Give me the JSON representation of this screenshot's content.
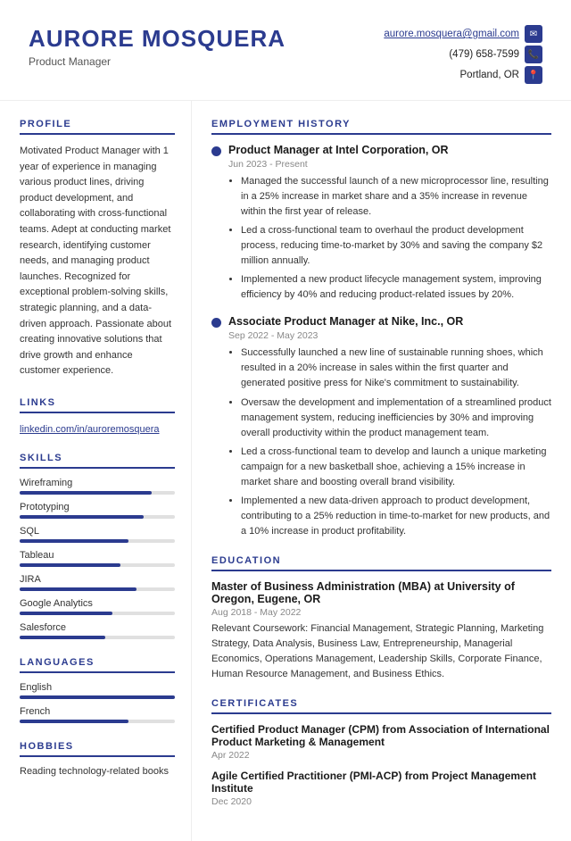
{
  "header": {
    "name": "AURORE MOSQUERA",
    "title": "Product Manager",
    "email": "aurore.mosquera@gmail.com",
    "phone": "(479) 658-7599",
    "location": "Portland, OR"
  },
  "profile": {
    "section_title": "PROFILE",
    "text": "Motivated Product Manager with 1 year of experience in managing various product lines, driving product development, and collaborating with cross-functional teams. Adept at conducting market research, identifying customer needs, and managing product launches. Recognized for exceptional problem-solving skills, strategic planning, and a data-driven approach. Passionate about creating innovative solutions that drive growth and enhance customer experience."
  },
  "links": {
    "section_title": "LINKS",
    "linkedin": "linkedin.com/in/auroremosquera"
  },
  "skills": {
    "section_title": "SKILLS",
    "items": [
      {
        "name": "Wireframing",
        "level": 85
      },
      {
        "name": "Prototyping",
        "level": 80
      },
      {
        "name": "SQL",
        "level": 70
      },
      {
        "name": "Tableau",
        "level": 65
      },
      {
        "name": "JIRA",
        "level": 75
      },
      {
        "name": "Google Analytics",
        "level": 60
      },
      {
        "name": "Salesforce",
        "level": 55
      }
    ]
  },
  "languages": {
    "section_title": "LANGUAGES",
    "items": [
      {
        "name": "English",
        "level": 100
      },
      {
        "name": "French",
        "level": 70
      }
    ]
  },
  "hobbies": {
    "section_title": "HOBBIES",
    "text": "Reading technology-related books"
  },
  "employment": {
    "section_title": "EMPLOYMENT HISTORY",
    "jobs": [
      {
        "title": "Product Manager at Intel Corporation, OR",
        "dates": "Jun 2023 - Present",
        "bullets": [
          "Managed the successful launch of a new microprocessor line, resulting in a 25% increase in market share and a 35% increase in revenue within the first year of release.",
          "Led a cross-functional team to overhaul the product development process, reducing time-to-market by 30% and saving the company $2 million annually.",
          "Implemented a new product lifecycle management system, improving efficiency by 40% and reducing product-related issues by 20%."
        ]
      },
      {
        "title": "Associate Product Manager at Nike, Inc., OR",
        "dates": "Sep 2022 - May 2023",
        "bullets": [
          "Successfully launched a new line of sustainable running shoes, which resulted in a 20% increase in sales within the first quarter and generated positive press for Nike's commitment to sustainability.",
          "Oversaw the development and implementation of a streamlined product management system, reducing inefficiencies by 30% and improving overall productivity within the product management team.",
          "Led a cross-functional team to develop and launch a unique marketing campaign for a new basketball shoe, achieving a 15% increase in market share and boosting overall brand visibility.",
          "Implemented a new data-driven approach to product development, contributing to a 25% reduction in time-to-market for new products, and a 10% increase in product profitability."
        ]
      }
    ]
  },
  "education": {
    "section_title": "EDUCATION",
    "degree": "Master of Business Administration (MBA) at University of Oregon, Eugene, OR",
    "dates": "Aug 2018 - May 2022",
    "coursework": "Relevant Coursework: Financial Management, Strategic Planning, Marketing Strategy, Data Analysis, Business Law, Entrepreneurship, Managerial Economics, Operations Management, Leadership Skills, Corporate Finance, Human Resource Management, and Business Ethics."
  },
  "certificates": {
    "section_title": "CERTIFICATES",
    "items": [
      {
        "title": "Certified Product Manager (CPM) from Association of International Product Marketing & Management",
        "date": "Apr 2022"
      },
      {
        "title": "Agile Certified Practitioner (PMI-ACP) from Project Management Institute",
        "date": "Dec 2020"
      }
    ]
  }
}
